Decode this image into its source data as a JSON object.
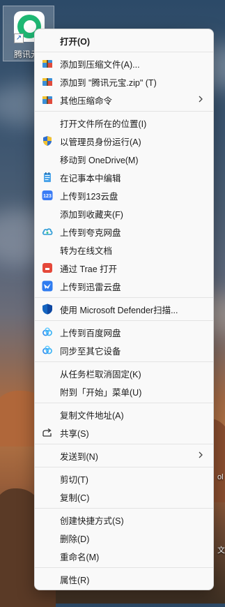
{
  "desktop": {
    "icon_label": "腾讯元宝",
    "shortcut_glyph": "↗",
    "right_snippet_top": "ol",
    "right_snippet_bottom": "文"
  },
  "menu": {
    "items": [
      {
        "label": "打开(O)",
        "bold": true,
        "icon": ""
      },
      {
        "sep": true
      },
      {
        "label": "添加到压缩文件(A)...",
        "icon": "archive-icon"
      },
      {
        "label": "添加到 \"腾讯元宝.zip\" (T)",
        "icon": "archive-icon"
      },
      {
        "label": "其他压缩命令",
        "icon": "archive-icon",
        "submenu": true
      },
      {
        "sep": true
      },
      {
        "label": "打开文件所在的位置(I)",
        "icon": ""
      },
      {
        "label": "以管理员身份运行(A)",
        "icon": "shield-icon"
      },
      {
        "label": "移动到 OneDrive(M)",
        "icon": ""
      },
      {
        "label": "在记事本中编辑",
        "icon": "notepad-icon"
      },
      {
        "label": "上传到123云盘",
        "icon": "cloud-123-icon"
      },
      {
        "label": "添加到收藏夹(F)",
        "icon": ""
      },
      {
        "label": "上传到夸克网盘",
        "icon": "quark-icon"
      },
      {
        "label": "转为在线文档",
        "icon": ""
      },
      {
        "label": "通过 Trae 打开",
        "icon": "trae-icon"
      },
      {
        "label": "上传到迅雷云盘",
        "icon": "thunder-icon"
      },
      {
        "sep": true
      },
      {
        "label": "使用 Microsoft Defender扫描...",
        "icon": "defender-icon"
      },
      {
        "sep": true
      },
      {
        "label": "上传到百度网盘",
        "icon": "baidu-icon"
      },
      {
        "label": "同步至其它设备",
        "icon": "baidu-icon"
      },
      {
        "sep": true
      },
      {
        "label": "从任务栏取消固定(K)",
        "icon": ""
      },
      {
        "label": "附到「开始」菜单(U)",
        "icon": ""
      },
      {
        "sep": true
      },
      {
        "label": "复制文件地址(A)",
        "icon": ""
      },
      {
        "label": "共享(S)",
        "icon": "share-icon"
      },
      {
        "sep": true
      },
      {
        "label": "发送到(N)",
        "icon": "",
        "submenu": true
      },
      {
        "sep": true
      },
      {
        "label": "剪切(T)",
        "icon": ""
      },
      {
        "label": "复制(C)",
        "icon": ""
      },
      {
        "sep": true
      },
      {
        "label": "创建快捷方式(S)",
        "icon": ""
      },
      {
        "label": "删除(D)",
        "icon": ""
      },
      {
        "label": "重命名(M)",
        "icon": ""
      },
      {
        "sep": true
      },
      {
        "label": "属性(R)",
        "icon": ""
      }
    ]
  },
  "colors": {
    "menu_bg": "#f9f9f9",
    "text": "#1b1b1b",
    "separator": "#e3e3e3"
  }
}
